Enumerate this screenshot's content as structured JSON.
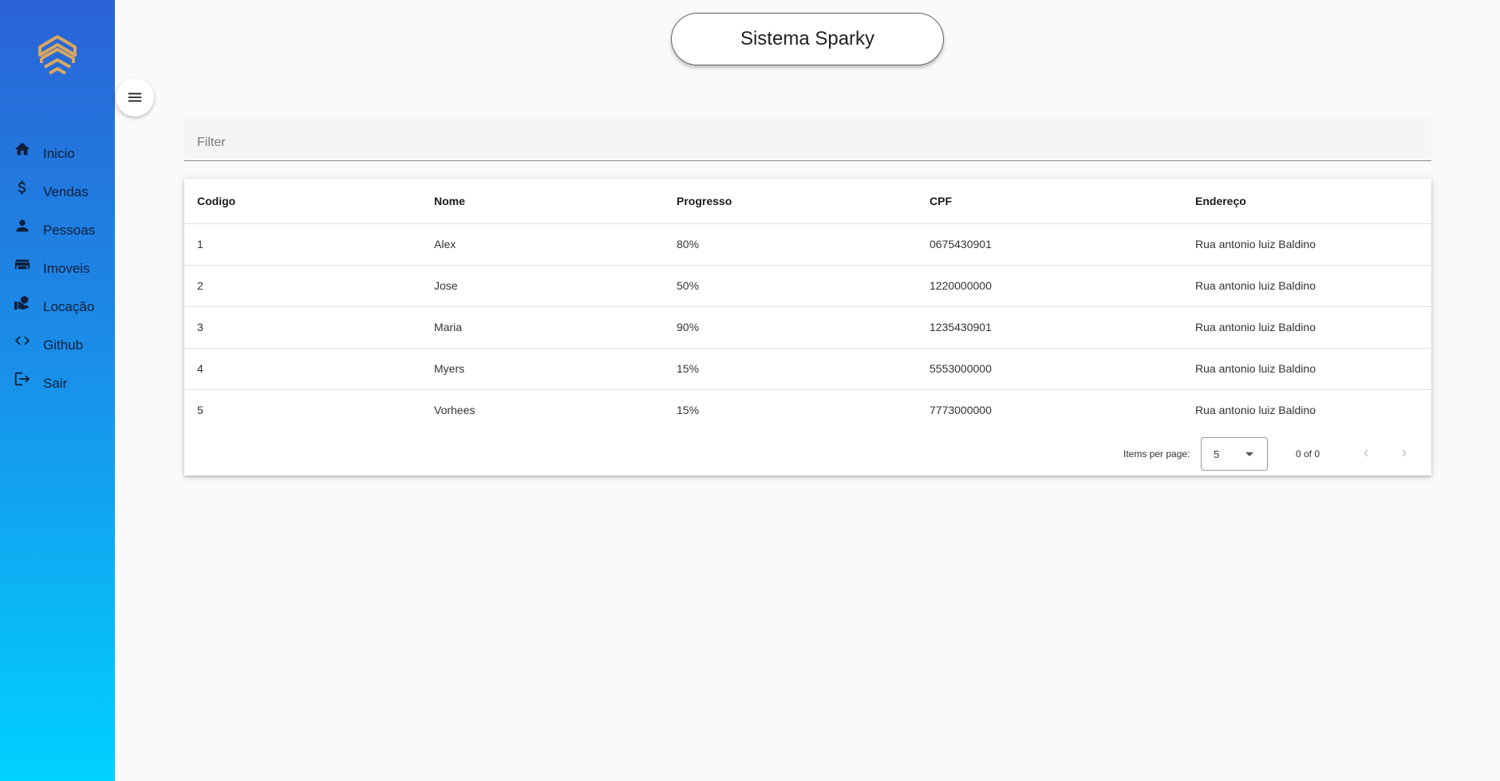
{
  "app": {
    "title": "Sistema Sparky"
  },
  "sidebar": {
    "items": [
      {
        "label": "Inicio",
        "icon": "home-icon"
      },
      {
        "label": "Vendas",
        "icon": "dollar-icon"
      },
      {
        "label": "Pessoas",
        "icon": "person-icon"
      },
      {
        "label": "Imoveis",
        "icon": "store-icon"
      },
      {
        "label": "Locação",
        "icon": "money-hand-icon"
      },
      {
        "label": "Github",
        "icon": "code-icon"
      },
      {
        "label": "Sair",
        "icon": "logout-icon"
      }
    ]
  },
  "filter": {
    "placeholder": "Filter"
  },
  "table": {
    "columns": [
      "Codigo",
      "Nome",
      "Progresso",
      "CPF",
      "Endereço"
    ],
    "rows": [
      [
        "1",
        "Alex",
        "80%",
        "0675430901",
        "Rua antonio luiz Baldino"
      ],
      [
        "2",
        "Jose",
        "50%",
        "1220000000",
        "Rua antonio luiz Baldino"
      ],
      [
        "3",
        "Maria",
        "90%",
        "1235430901",
        "Rua antonio luiz Baldino"
      ],
      [
        "4",
        "Myers",
        "15%",
        "5553000000",
        "Rua antonio luiz Baldino"
      ],
      [
        "5",
        "Vorhees",
        "15%",
        "7773000000",
        "Rua antonio luiz Baldino"
      ]
    ]
  },
  "paginator": {
    "items_per_page_label": "Items per page:",
    "page_size": "5",
    "range_label": "0 of 0"
  },
  "colors": {
    "sidebar_top": "#2a63d6",
    "sidebar_bottom": "#00d2ff",
    "logo": "#d9a760"
  }
}
